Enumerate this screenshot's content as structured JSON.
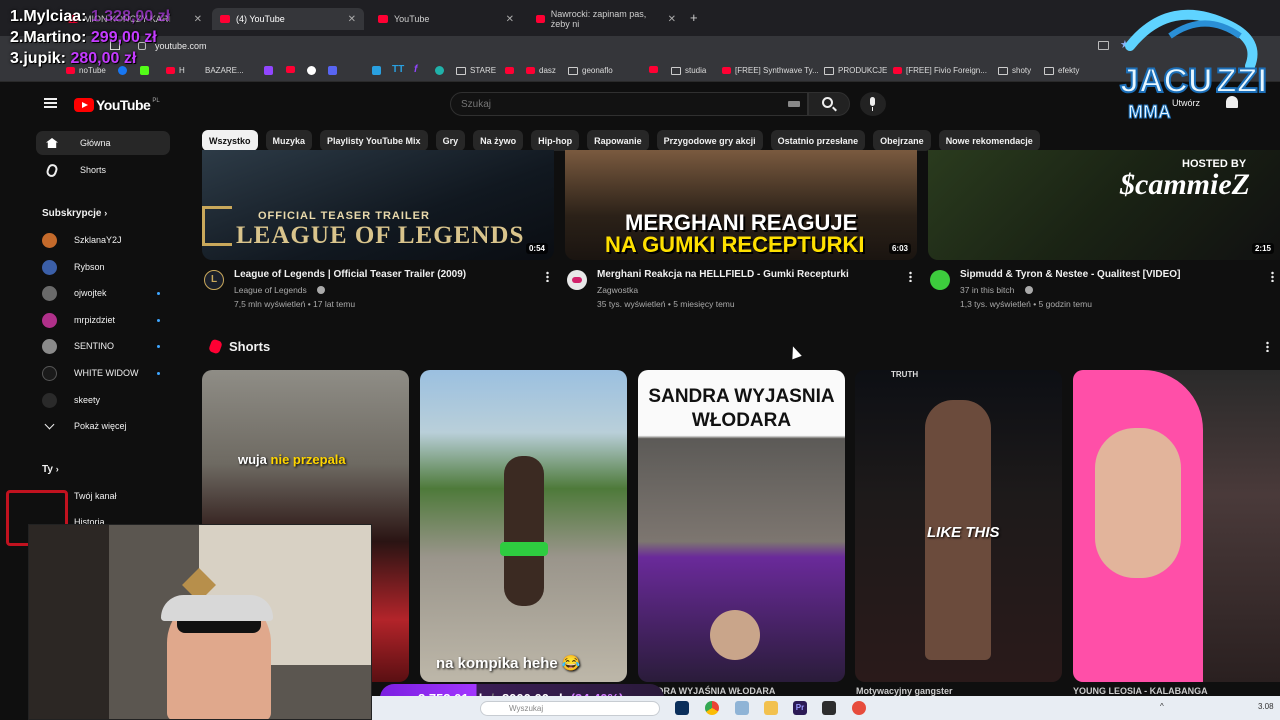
{
  "overlay": {
    "leaderboard": [
      {
        "rank": "1.",
        "name": "Mylciaa:",
        "amount": "1 328,00 zł"
      },
      {
        "rank": "2.",
        "name": "Martino:",
        "amount": "299,00 zł"
      },
      {
        "rank": "3.",
        "name": "jupik:",
        "amount": "280,00 zł"
      }
    ],
    "donation": {
      "current": "2 752,01 zł",
      "goal": "8000,00 zł",
      "percent": "(34,40%)",
      "progress": 0.344
    },
    "logo_text": [
      "JACU",
      "ZZI",
      "MMA"
    ]
  },
  "browser": {
    "tabs": [
      {
        "label": "MION KOŃCZY KARI"
      },
      {
        "label": "(4) YouTube"
      },
      {
        "label": "YouTube"
      },
      {
        "label": "Nawrocki: zapinam pas, żeby ni"
      }
    ],
    "url": "youtube.com",
    "bookmarks": [
      {
        "label": "noTube"
      },
      {
        "label": "H"
      },
      {
        "label": "BAZARE..."
      },
      {
        "label": "STARE"
      },
      {
        "label": "dasz"
      },
      {
        "label": "geonaflo"
      },
      {
        "label": "studia"
      },
      {
        "label": "[FREE] Synthwave Ty..."
      },
      {
        "label": "PRODUKCJE"
      },
      {
        "label": "[FREE] Fivio Foreign..."
      },
      {
        "label": "shoty"
      },
      {
        "label": "efekty"
      }
    ]
  },
  "youtube": {
    "logo": "YouTube",
    "country": "PL",
    "search_placeholder": "Szukaj",
    "create_label": "Utwórz",
    "chips": [
      "Wszystko",
      "Muzyka",
      "Playlisty YouTube Mix",
      "Gry",
      "Na żywo",
      "Hip-hop",
      "Rapowanie",
      "Przygodowe gry akcji",
      "Ostatnio przesłane",
      "Obejrzane",
      "Nowe rekomendacje"
    ],
    "sidebar": {
      "main": [
        {
          "label": "Główna"
        },
        {
          "label": "Shorts"
        }
      ],
      "subscriptions_heading": "Subskrypcje",
      "subscriptions": [
        {
          "label": "SzklanaY2J",
          "color": "#c46a2b"
        },
        {
          "label": "Rybson",
          "color": "#3b5fa8"
        },
        {
          "label": "ojwojtek",
          "color": "#6a6a6a"
        },
        {
          "label": "mrpizdziet",
          "color": "#b0308a"
        },
        {
          "label": "SENTINO",
          "color": "#8a8a8a"
        },
        {
          "label": "WHITE WIDOW",
          "color": "#1a1a1a"
        },
        {
          "label": "skeety",
          "color": "#2a2a2a"
        }
      ],
      "show_more": "Pokaż więcej",
      "you_heading": "Ty",
      "you_items": [
        {
          "label": "Twój kanał"
        },
        {
          "label": "Historia"
        }
      ]
    },
    "videos": [
      {
        "thumb_title": "OFFICIAL TEASER TRAILER",
        "thumb_big": "LEAGUE OF LEGENDS",
        "duration": "0:54",
        "title": "League of Legends | Official Teaser Trailer (2009)",
        "channel": "League of Legends",
        "meta": "7,5 mln wyświetleń • 17 lat temu",
        "avatar_letter": "L"
      },
      {
        "thumb_title": "MERGHANI REAGUJE",
        "thumb_big": "NA GUMKI RECEPTURKI",
        "duration": "6:03",
        "title": "Merghani Reakcja na HELLFIELD - Gumki Recepturki",
        "channel": "Zagwostka",
        "meta": "35 tys. wyświetleń • 5 miesięcy temu",
        "avatar_letter": ""
      },
      {
        "thumb_title": "HOSTED BY",
        "thumb_big": "$cammieZ",
        "duration": "2:15",
        "title": "Sipmudd & Tyron & Nestee - Qualitest [VIDEO]",
        "channel": "37 in this bitch",
        "meta": "1,3 tys. wyświetleń • 5 godzin temu",
        "avatar_letter": ""
      }
    ],
    "shorts_heading": "Shorts",
    "shorts": [
      {
        "caption_a": "wuja ",
        "caption_b": "nie przepala",
        "bottom": ""
      },
      {
        "caption_a": "na kompika hehe 😂",
        "caption_b": "",
        "bottom": ""
      },
      {
        "caption_a": "SANDRA WYJASNIA",
        "caption_b": "WŁODARA",
        "bottom": "SANDRA WYJAŚNIA WŁODARA"
      },
      {
        "caption_a": "LIKE THIS",
        "caption_b": "TRUTH",
        "bottom": "Motywacyjny gangster"
      },
      {
        "caption_a": "",
        "caption_b": "",
        "bottom": "YOUNG LEOSIA - KALABANGA"
      }
    ]
  },
  "taskbar": {
    "search_placeholder": "Wyszukaj",
    "time": "3.08"
  },
  "colors": {
    "youtube_red": "#ff0000",
    "background": "#0f0f0f",
    "chip": "#272727",
    "donation_purple": "#a236ff"
  }
}
